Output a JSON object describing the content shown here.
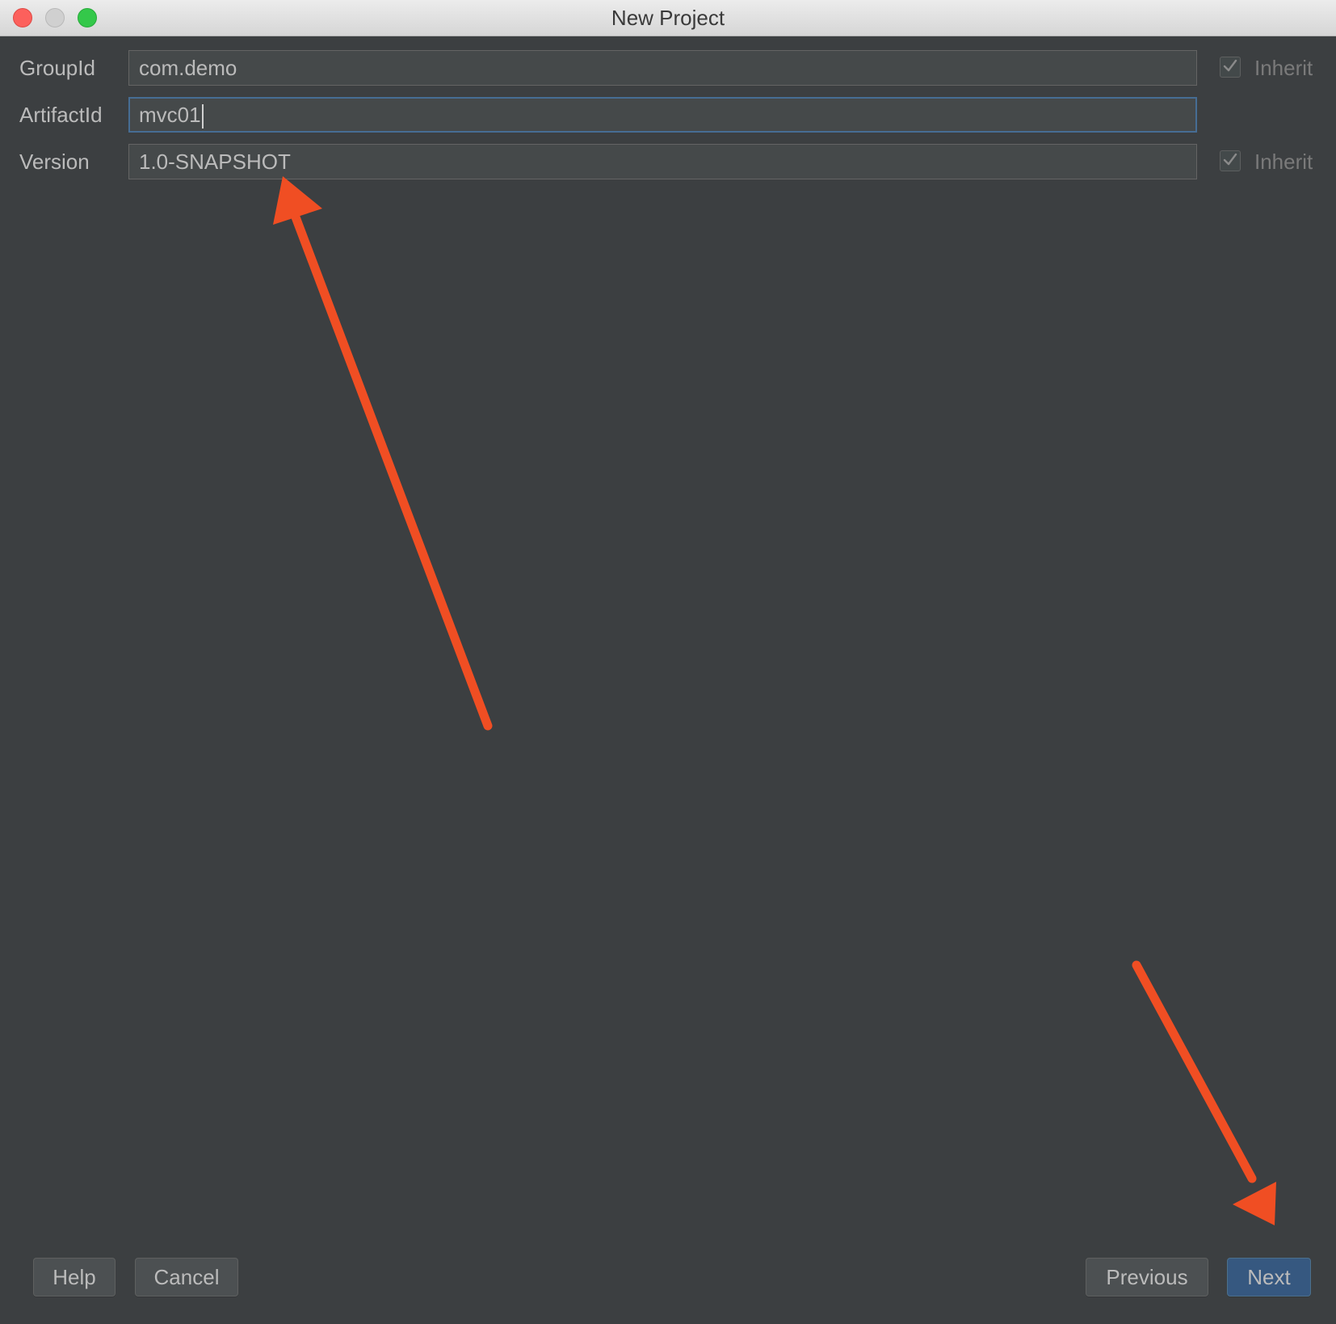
{
  "window": {
    "title": "New Project"
  },
  "form": {
    "group_id": {
      "label": "GroupId",
      "value": "com.demo",
      "inherit_label": "Inherit",
      "inherit_checked": true
    },
    "artifact_id": {
      "label": "ArtifactId",
      "value": "mvc01"
    },
    "version": {
      "label": "Version",
      "value": "1.0-SNAPSHOT",
      "inherit_label": "Inherit",
      "inherit_checked": true
    }
  },
  "buttons": {
    "help": "Help",
    "cancel": "Cancel",
    "previous": "Previous",
    "next": "Next"
  },
  "colors": {
    "background": "#3c3f41",
    "annotation_arrow": "#f04e23",
    "default_button": "#365880"
  },
  "icons": {
    "close": "close-traffic-light",
    "minimize": "minimize-traffic-light",
    "maximize": "maximize-traffic-light",
    "checkbox": "checkmark-icon",
    "annotation": "red-arrow"
  }
}
